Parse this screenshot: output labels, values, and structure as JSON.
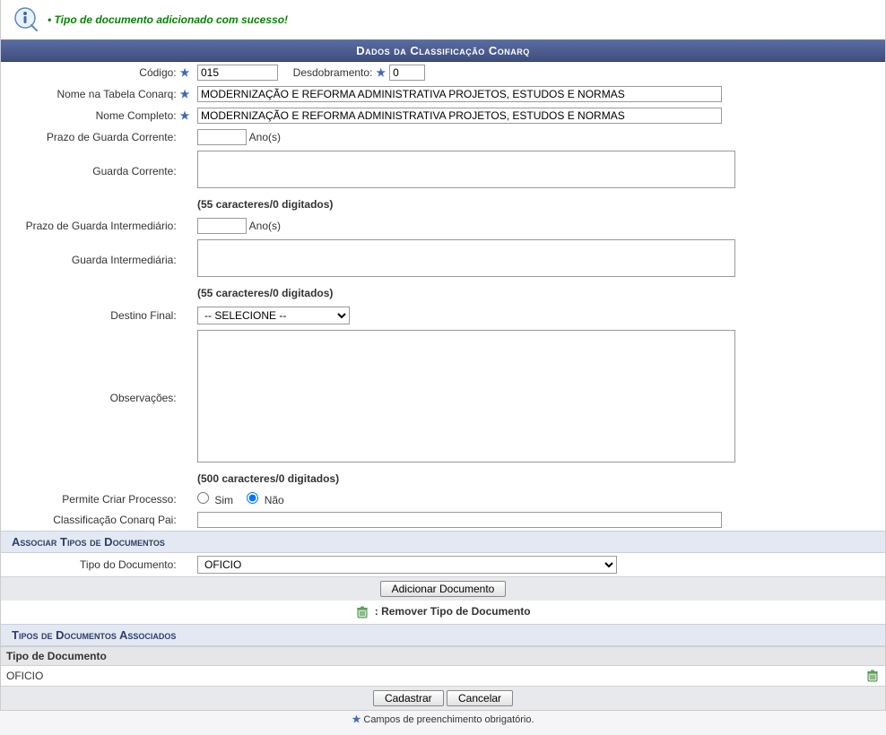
{
  "messages": {
    "success": "Tipo de documento adicionado com sucesso!"
  },
  "sections": {
    "main_header": "Dados da Classificação Conarq",
    "assoc_header": "Associar Tipos de Documentos",
    "assoc_list_header": "Tipos de Documentos Associados"
  },
  "labels": {
    "codigo": "Código:",
    "desdobramento": "Desdobramento:",
    "nome_tabela": "Nome na Tabela Conarq:",
    "nome_completo": "Nome Completo:",
    "prazo_guarda_corrente": "Prazo de Guarda Corrente:",
    "guarda_corrente": "Guarda Corrente:",
    "prazo_guarda_inter": "Prazo de Guarda Intermediário:",
    "guarda_inter": "Guarda Intermediária:",
    "destino_final": "Destino Final:",
    "observacoes": "Observações:",
    "permite_processo": "Permite Criar Processo:",
    "conarq_pai": "Classificação Conarq Pai:",
    "tipo_documento": "Tipo do Documento:",
    "anos": "Ano(s)"
  },
  "values": {
    "codigo": "015",
    "desdobramento": "0",
    "nome_tabela": "MODERNIZAÇÃO E REFORMA ADMINISTRATIVA PROJETOS, ESTUDOS E NORMAS",
    "nome_completo": "MODERNIZAÇÃO E REFORMA ADMINISTRATIVA PROJETOS, ESTUDOS E NORMAS",
    "prazo_corrente": "",
    "guarda_corrente": "",
    "prazo_inter": "",
    "guarda_inter": "",
    "destino_final": "-- SELECIONE --",
    "observacoes": "",
    "permite_sim": "Sim",
    "permite_nao": "Não",
    "conarq_pai": "",
    "tipo_documento_sel": "OFICIO"
  },
  "counters": {
    "guarda_corrente": "(55 caracteres/0 digitados)",
    "guarda_inter": "(55 caracteres/0 digitados)",
    "observacoes": "(500 caracteres/0 digitados)"
  },
  "buttons": {
    "adicionar_doc": "Adicionar Documento",
    "cadastrar": "Cadastrar",
    "cancelar": "Cancelar"
  },
  "instructions": {
    "remover": ": Remover Tipo de Documento"
  },
  "assoc_table": {
    "col_header": "Tipo de Documento",
    "rows": [
      {
        "tipo": "OFICIO"
      }
    ]
  },
  "footer": {
    "required_note": "Campos de preenchimento obrigatório."
  }
}
